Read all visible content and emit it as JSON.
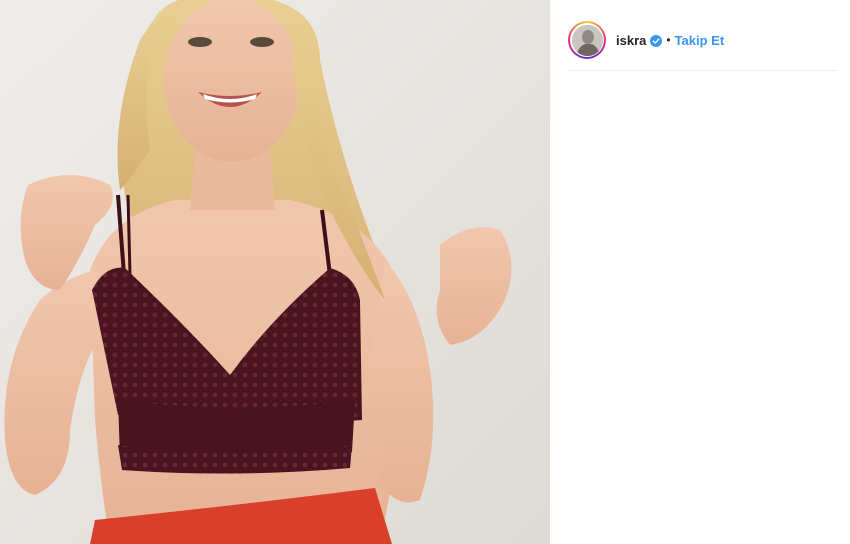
{
  "post": {
    "username": "iskra",
    "separator": "•",
    "follow_label": "Takip Et",
    "verified": true,
    "avatar_icon": "avatar",
    "verified_icon": "verified-badge-icon",
    "accent_color": "#3897f0"
  },
  "photo": {
    "description_icon": "post-image"
  }
}
